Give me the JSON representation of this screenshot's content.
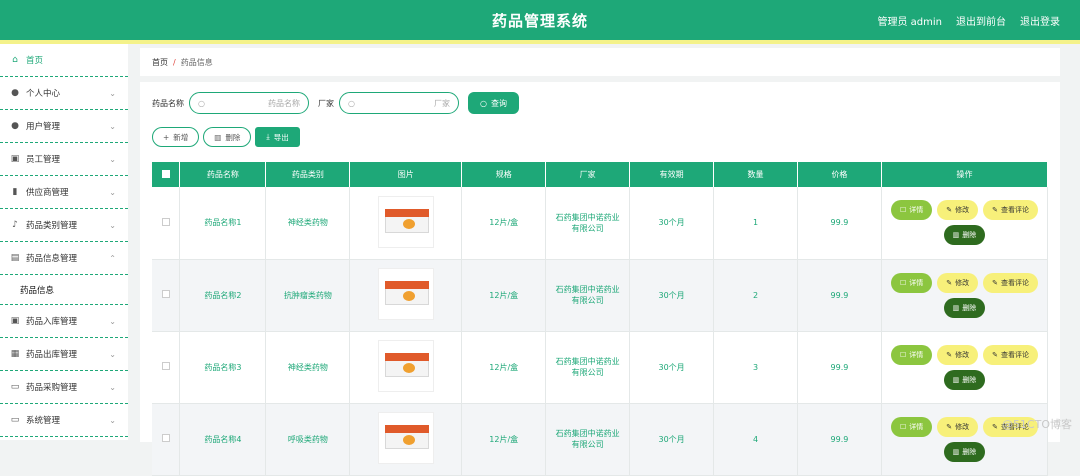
{
  "header": {
    "title": "药品管理系统",
    "user": "管理员 admin",
    "backend": "退出到前台",
    "logout": "退出登录"
  },
  "sidebar": {
    "items": [
      {
        "label": "首页",
        "icon": "home-icon",
        "glyph": "⌂",
        "chev": ""
      },
      {
        "label": "个人中心",
        "icon": "person-icon",
        "glyph": "●",
        "chev": "⌄"
      },
      {
        "label": "用户管理",
        "icon": "location-icon",
        "glyph": "●",
        "chev": "⌄"
      },
      {
        "label": "员工管理",
        "icon": "document-icon",
        "glyph": "▣",
        "chev": "⌄"
      },
      {
        "label": "供应商管理",
        "icon": "bar-chart-icon",
        "glyph": "▮",
        "chev": "⌄"
      },
      {
        "label": "药品类别管理",
        "icon": "microphone-icon",
        "glyph": "♪",
        "chev": "⌄"
      },
      {
        "label": "药品信息管理",
        "icon": "briefcase-icon",
        "glyph": "▤",
        "chev": "⌃"
      }
    ],
    "sub": "药品信息",
    "items2": [
      {
        "label": "药品入库管理",
        "icon": "checklist-icon",
        "glyph": "▣",
        "chev": "⌄"
      },
      {
        "label": "药品出库管理",
        "icon": "table-icon",
        "glyph": "▦",
        "chev": "⌄"
      },
      {
        "label": "药品采购管理",
        "icon": "monitor-icon",
        "glyph": "▭",
        "chev": "⌄"
      },
      {
        "label": "系统管理",
        "icon": "display-icon",
        "glyph": "▭",
        "chev": "⌄"
      }
    ]
  },
  "breadcrumb": {
    "home": "首页",
    "sep": "/",
    "current": "药品信息"
  },
  "search": {
    "label1": "药品名称",
    "placeholder1": "药品名称",
    "label2": "厂家",
    "placeholder2": "厂家",
    "btn": "查询"
  },
  "actions": {
    "add": "新增",
    "del": "删除",
    "export": "导出"
  },
  "table": {
    "headers": [
      "药品名称",
      "药品类别",
      "图片",
      "规格",
      "厂家",
      "有效期",
      "数量",
      "价格",
      "操作"
    ],
    "rows": [
      {
        "name": "药品名称1",
        "cat": "神经类药物",
        "spec": "12片/盒",
        "maker": "石药集团中诺药业有限公司",
        "exp": "30个月",
        "qty": "1",
        "price": "99.9"
      },
      {
        "name": "药品名称2",
        "cat": "抗肿瘤类药物",
        "spec": "12片/盒",
        "maker": "石药集团中诺药业有限公司",
        "exp": "30个月",
        "qty": "2",
        "price": "99.9"
      },
      {
        "name": "药品名称3",
        "cat": "神经类药物",
        "spec": "12片/盒",
        "maker": "石药集团中诺药业有限公司",
        "exp": "30个月",
        "qty": "3",
        "price": "99.9"
      },
      {
        "name": "药品名称4",
        "cat": "呼吸类药物",
        "spec": "12片/盒",
        "maker": "石药集团中诺药业有限公司",
        "exp": "30个月",
        "qty": "4",
        "price": "99.9"
      }
    ],
    "ops": {
      "detail": "详情",
      "edit": "修改",
      "review": "查看评论",
      "del": "删除"
    }
  },
  "watermark": "@51CTO博客"
}
